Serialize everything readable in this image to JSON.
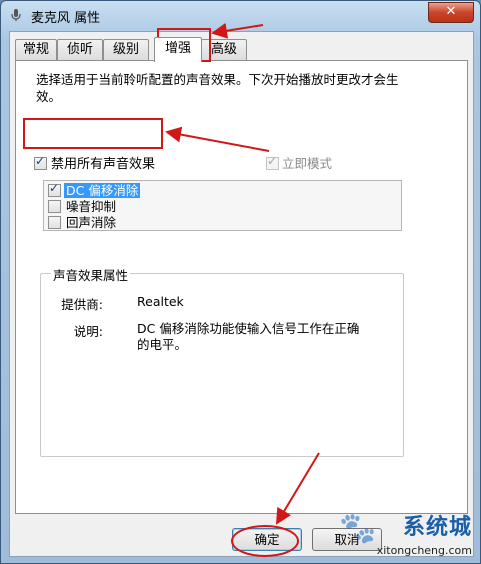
{
  "window": {
    "title": "麦克风 属性",
    "close_symbol": "✕",
    "app_icon": "microphone-icon"
  },
  "tabs": [
    {
      "label": "常规",
      "active": false
    },
    {
      "label": "侦听",
      "active": false
    },
    {
      "label": "级别",
      "active": false
    },
    {
      "label": "增强",
      "active": true
    },
    {
      "label": "高级",
      "active": false
    }
  ],
  "enhancements": {
    "description": "选择适用于当前聆听配置的声音效果。下次开始播放时更改才会生效。",
    "disable_all": {
      "label": "禁用所有声音效果",
      "checked": true
    },
    "immediate_mode": {
      "label": "立即模式",
      "checked": true,
      "enabled": false
    },
    "effects": [
      {
        "label": "DC 偏移消除",
        "checked": true,
        "selected": true
      },
      {
        "label": "噪音抑制",
        "checked": false,
        "selected": false
      },
      {
        "label": "回声消除",
        "checked": false,
        "selected": false
      }
    ],
    "properties": {
      "group_title": "声音效果属性",
      "provider_label": "提供商:",
      "provider_value": "Realtek",
      "description_label": "说明:",
      "description_value": "DC 偏移消除功能使输入信号工作在正确的电平。"
    }
  },
  "buttons": {
    "ok": "确定",
    "cancel": "取消"
  },
  "watermark": {
    "logo": "系统城",
    "url": "xitongcheng.com"
  },
  "annotation_color": "#d21717",
  "selection_color": "#3399ff"
}
